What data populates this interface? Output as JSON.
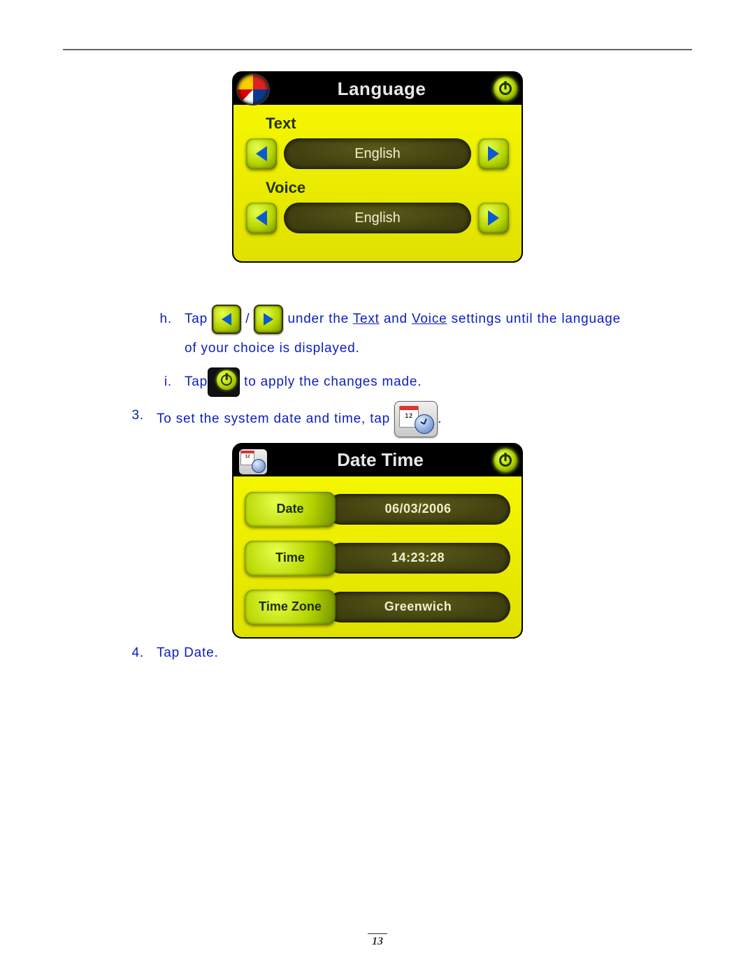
{
  "page_number": "13",
  "language_screen": {
    "title": "Language",
    "text_label": "Text",
    "text_value": "English",
    "voice_label": "Voice",
    "voice_value": "English"
  },
  "instructions": {
    "h_marker": "h.",
    "h_pre": "Tap ",
    "h_slash": " / ",
    "h_mid": " under the ",
    "h_text_word": "Text",
    "h_and": " and ",
    "h_voice_word": "Voice",
    "h_tail": " settings until the language",
    "h_line2": "of your choice is displayed.",
    "i_marker": "i.",
    "i_pre": "Tap",
    "i_post": " to apply the changes made.",
    "step3_marker": "3.",
    "step3_text": "To set the system date and time, tap ",
    "step3_tail": ".",
    "step4_marker": "4.",
    "step4_text": "Tap Date."
  },
  "datetime_screen": {
    "title": "Date Time",
    "date_label": "Date",
    "date_value": "06/03/2006",
    "time_label": "Time",
    "time_value": "14:23:28",
    "tz_label": "Time Zone",
    "tz_value": "Greenwich",
    "calendar_day": "12"
  }
}
